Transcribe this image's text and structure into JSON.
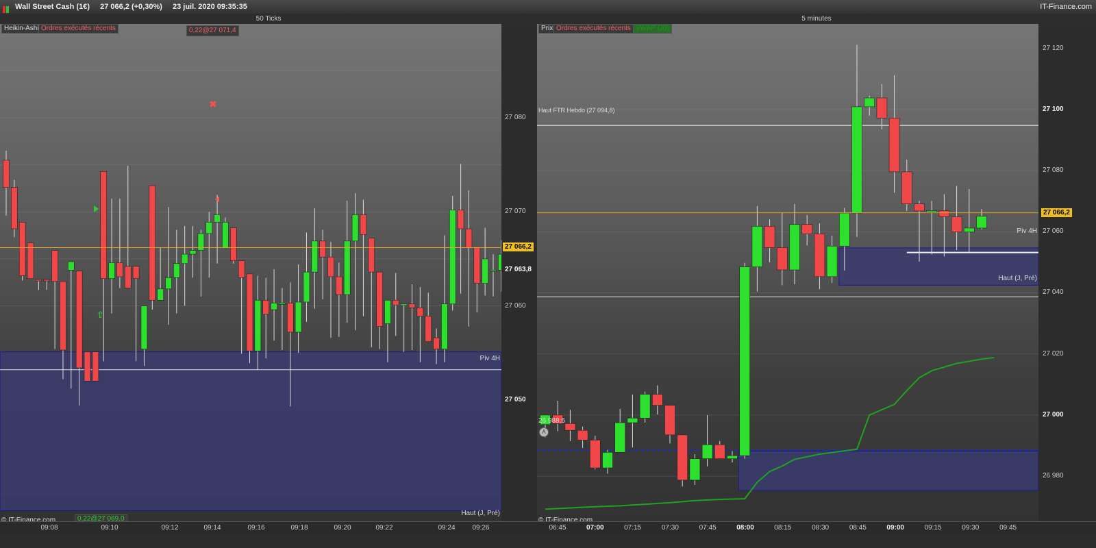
{
  "window": {
    "instrument": "Wall Street Cash (1€)",
    "price_change": "27 066,2 (+0,30%)",
    "datetime": "23 juil. 2020 09:35:35",
    "brand": "IT-Finance.com"
  },
  "colors": {
    "up": "#2ee02e",
    "down": "#f04848",
    "zone": "#3b3b6e",
    "current": "#e8a020"
  },
  "left_panel": {
    "title": "50 Ticks",
    "legend_main": "Heikin-Ashi",
    "legend_orders": "Ordres exécutés récents",
    "order_top": "0,22@27 071,4",
    "order_bottom": "0,22@27 069,0",
    "zone_label": "Piv 4H",
    "line_label": "Haut (J, Pré)",
    "watermark": "© IT-Finance.com",
    "current_price": "27 066,2",
    "last_price": "27 063,8",
    "yticks": [
      {
        "v": 27080,
        "t": "27 080"
      },
      {
        "v": 27070,
        "t": "27 070"
      },
      {
        "v": 27060,
        "t": "27 060"
      },
      {
        "v": 27050,
        "t": "27 050",
        "bold": true
      }
    ],
    "xticks": [
      "09:08",
      "09:10",
      "09:12",
      "09:14",
      "09:16",
      "09:18",
      "09:20",
      "09:22",
      "09:24",
      "09:26"
    ]
  },
  "right_panel": {
    "title": "5 minutes",
    "legend_main": "Prix",
    "legend_orders": "Ordres exécutés récents",
    "legend_vwap": "VWAP (J0)",
    "level_weekly": "Haut FTR Hebdo (27 094,8)",
    "level_pivot": "Piv 4H",
    "level_prev_high": "Haut (J, Pré)",
    "level_low": "26 988,6",
    "watermark": "© IT-Finance.com",
    "current_price": "27 066,2",
    "yticks": [
      {
        "v": 27120,
        "t": "27 120"
      },
      {
        "v": 27100,
        "t": "27 100",
        "bold": true
      },
      {
        "v": 27080,
        "t": "27 080"
      },
      {
        "v": 27060,
        "t": "27 060"
      },
      {
        "v": 27040,
        "t": "27 040"
      },
      {
        "v": 27020,
        "t": "27 020"
      },
      {
        "v": 27000,
        "t": "27 000",
        "bold": true
      },
      {
        "v": 26980,
        "t": "26 980"
      }
    ],
    "xticks": [
      {
        "t": "06:45"
      },
      {
        "t": "07:00",
        "bold": true
      },
      {
        "t": "07:15"
      },
      {
        "t": "07:30"
      },
      {
        "t": "07:45"
      },
      {
        "t": "08:00",
        "bold": true
      },
      {
        "t": "08:15"
      },
      {
        "t": "08:30"
      },
      {
        "t": "08:45"
      },
      {
        "t": "09:00",
        "bold": true
      },
      {
        "t": "09:15"
      },
      {
        "t": "09:30"
      },
      {
        "t": "09:45"
      }
    ]
  },
  "chart_data": [
    {
      "type": "candlestick",
      "title": "50 Ticks",
      "style": "Heikin-Ashi",
      "ylim": [
        27037,
        27090
      ],
      "current_price": 27066.2,
      "zone": {
        "name": "Piv 4H",
        "low": 27038.2,
        "high": 27055.1
      },
      "level": 27053.2,
      "candles": [
        [
          27075.5,
          27076.5,
          27069.6,
          27072.6
        ],
        [
          27072.6,
          27073.4,
          27067.3,
          27068.2
        ],
        [
          27068.9,
          27068.9,
          27062.7,
          27063.2
        ],
        [
          27066.7,
          27066.7,
          27062.9,
          27062.9
        ],
        [
          27062.8,
          27062.8,
          27061.7,
          27062.7
        ],
        [
          27062.8,
          27062.8,
          27061.7,
          27062.7
        ],
        [
          27065.9,
          27065.9,
          27055.4,
          27062.6
        ],
        [
          27062.6,
          27062.6,
          27052.2,
          27055.3
        ],
        [
          27063.8,
          27063.8,
          27051.2,
          27064.7
        ],
        [
          27063.7,
          27063.7,
          27049.4,
          27053.4
        ],
        [
          27055.1,
          27055.1,
          27054.6,
          27052.0
        ],
        [
          27055.1,
          27055.1,
          27054.6,
          27052.0
        ],
        [
          27074.3,
          27074.3,
          27054.1,
          27062.9
        ],
        [
          27062.9,
          27071.4,
          27059.2,
          27064.6
        ],
        [
          27064.6,
          27071.4,
          27061.9,
          27063.1
        ],
        [
          27064.2,
          27074.9,
          27063.4,
          27061.9
        ],
        [
          27064.2,
          27064.2,
          27054.1,
          27062.9
        ],
        [
          27055.4,
          27055.4,
          27053.6,
          27060.0
        ],
        [
          27072.8,
          27072.8,
          27059.6,
          27060.6
        ],
        [
          27060.6,
          27066.2,
          27061.7,
          27061.8
        ],
        [
          27061.8,
          27070.5,
          27058.0,
          27063.0
        ],
        [
          27063.0,
          27068.1,
          27059.2,
          27064.5
        ],
        [
          27064.5,
          27068.5,
          27060.0,
          27065.5
        ],
        [
          27065.5,
          27068.5,
          27063.0,
          27065.9
        ],
        [
          27065.9,
          27068.1,
          27061.0,
          27067.7
        ],
        [
          27067.7,
          27070.0,
          27063.0,
          27068.9
        ],
        [
          27068.9,
          27071.8,
          27064.5,
          27069.7
        ],
        [
          27066.2,
          27069.4,
          27066.4,
          27068.9
        ],
        [
          27068.3,
          27068.3,
          27064.5,
          27064.8
        ],
        [
          27064.8,
          27064.8,
          27054.9,
          27063.0
        ],
        [
          27063.4,
          27063.4,
          27053.9,
          27055.2
        ],
        [
          27055.2,
          27063.2,
          27053.2,
          27060.6
        ],
        [
          27060.6,
          27063.0,
          27054.4,
          27059.1
        ],
        [
          27059.6,
          27063.9,
          27056.3,
          27060.3
        ],
        [
          27060.3,
          27061.9,
          27055.3,
          27060.3
        ],
        [
          27060.3,
          27062.5,
          27049.3,
          27057.2
        ],
        [
          27057.2,
          27064.4,
          27055.0,
          27060.4
        ],
        [
          27060.4,
          27067.8,
          27058.3,
          27063.6
        ],
        [
          27063.6,
          27070.4,
          27059.7,
          27066.9
        ],
        [
          27066.9,
          27068.1,
          27060.7,
          27065.2
        ],
        [
          27065.2,
          27066.8,
          27056.6,
          27063.1
        ],
        [
          27063.1,
          27064.6,
          27056.7,
          27061.2
        ],
        [
          27061.2,
          27071.2,
          27058.2,
          27066.9
        ],
        [
          27066.9,
          27072.0,
          27057.4,
          27069.7
        ],
        [
          27069.7,
          27071.3,
          27058.9,
          27067.6
        ],
        [
          27067.2,
          27067.2,
          27055.6,
          27063.6
        ],
        [
          27063.6,
          27063.6,
          27055.4,
          27057.8
        ],
        [
          27058.1,
          27060.5,
          27054.0,
          27060.6
        ],
        [
          27060.6,
          27063.5,
          27056.8,
          27060.1
        ],
        [
          27060.1,
          27060.2,
          27055.1,
          27060.2
        ],
        [
          27060.2,
          27062.3,
          27055.3,
          27059.8
        ],
        [
          27059.8,
          27062.0,
          27054.0,
          27058.9
        ],
        [
          27058.9,
          27061.4,
          27058.2,
          27056.2
        ],
        [
          27056.6,
          27057.6,
          27053.8,
          27055.4
        ],
        [
          27055.4,
          27067.5,
          27054.0,
          27060.2
        ],
        [
          27060.2,
          27071.7,
          27059.5,
          27070.2
        ],
        [
          27070.2,
          27075.1,
          27061.3,
          27068.2
        ],
        [
          27068.2,
          27072.3,
          27057.8,
          27066.2
        ],
        [
          27066.2,
          27066.2,
          27059.3,
          27062.4
        ],
        [
          27062.4,
          27068.3,
          27061.1,
          27065.0
        ],
        [
          27063.8,
          27065.5,
          27061.0,
          27063.8
        ],
        [
          27063.8,
          27067.0,
          27061.5,
          27065.5
        ]
      ]
    },
    {
      "type": "candlestick",
      "title": "5 minutes",
      "ylim": [
        26965,
        27128
      ],
      "current_price": 27066.2,
      "levels": [
        {
          "name": "Haut FTR Hebdo",
          "value": 27094.8
        },
        {
          "name": "Haut (J, Pré)",
          "value": 27038.7
        },
        {
          "name": "26 988,6",
          "value": 26988.6,
          "style": "dashed"
        }
      ],
      "zones": [
        {
          "name": "Piv 4H",
          "from_index": 24,
          "low": 27042.5,
          "high": 27054.7
        },
        {
          "name": "zone-low",
          "from_index": 16,
          "low": 26975.3,
          "high": 26988.2
        }
      ],
      "candles": [
        [
          26996.9,
          27000.0,
          26992.7,
          27000.0
        ],
        [
          27000.0,
          27004.7,
          26994.7,
          26997.2
        ],
        [
          26997.2,
          27001.7,
          26991.5,
          26995.0
        ],
        [
          26995.0,
          26996.2,
          26989.2,
          26991.8
        ],
        [
          26991.8,
          26993.2,
          26982.2,
          26982.7
        ],
        [
          26982.7,
          26988.6,
          26980.8,
          26987.8
        ],
        [
          26987.8,
          27002.0,
          26987.8,
          26997.5
        ],
        [
          26997.5,
          27006.7,
          26989.4,
          26999.0
        ],
        [
          26999.0,
          27007.7,
          26997.5,
          27006.8
        ],
        [
          27006.8,
          27009.7,
          27000.2,
          27003.2
        ],
        [
          27003.2,
          27003.2,
          26990.7,
          26993.5
        ],
        [
          26993.5,
          26993.5,
          26976.6,
          26978.7
        ],
        [
          26978.7,
          26987.2,
          26977.1,
          26985.7
        ],
        [
          26985.7,
          27000.0,
          26983.2,
          26990.3
        ],
        [
          26990.3,
          26991.5,
          26986.2,
          26985.7
        ],
        [
          26985.7,
          26988.2,
          26984.5,
          26986.7
        ],
        [
          26986.7,
          27049.8,
          26985.7,
          27048.5
        ],
        [
          27048.5,
          27068.4,
          27040.4,
          27061.8
        ],
        [
          27061.8,
          27064.0,
          27050.0,
          27054.8
        ],
        [
          27054.8,
          27066.2,
          27042.5,
          27047.5
        ],
        [
          27047.5,
          27069.1,
          27042.8,
          27062.4
        ],
        [
          27062.4,
          27065.5,
          27055.5,
          27059.3
        ],
        [
          27059.3,
          27062.7,
          27041.2,
          27045.3
        ],
        [
          27045.3,
          27058.7,
          27043.2,
          27055.3
        ],
        [
          27055.3,
          27067.8,
          27047.3,
          27066.1
        ],
        [
          27066.1,
          27121.2,
          27058.3,
          27100.9
        ],
        [
          27100.9,
          27104.5,
          27098.0,
          27103.8
        ],
        [
          27103.8,
          27108.3,
          27093.5,
          27097.2
        ],
        [
          27097.2,
          27111.2,
          27072.8,
          27079.6
        ],
        [
          27079.6,
          27083.6,
          27066.8,
          27069.1
        ],
        [
          27069.1,
          27070.1,
          27050.2,
          27066.8
        ],
        [
          27066.8,
          27070.1,
          27052.6,
          27066.9
        ],
        [
          27066.9,
          27072.3,
          27051.9,
          27064.9
        ],
        [
          27064.9,
          27075.0,
          27054.0,
          27059.9
        ],
        [
          27059.9,
          27074.0,
          27053.4,
          27061.2
        ],
        [
          27061.2,
          27067.4,
          27060.8,
          27065.1
        ]
      ],
      "vwap": [
        [
          0,
          26969.2
        ],
        [
          2,
          26969.6
        ],
        [
          4,
          26970.0
        ],
        [
          6,
          26970.3
        ],
        [
          8,
          26970.8
        ],
        [
          10,
          26971.3
        ],
        [
          12,
          26972.0
        ],
        [
          14,
          26972.4
        ],
        [
          16,
          26972.6
        ],
        [
          17,
          26978.0
        ],
        [
          18,
          26981.5
        ],
        [
          19,
          26983.3
        ],
        [
          20,
          26985.5
        ],
        [
          22,
          26987.2
        ],
        [
          24,
          26988.3
        ],
        [
          25,
          26988.8
        ],
        [
          26,
          27000.0
        ],
        [
          28,
          27003.5
        ],
        [
          29,
          27008.0
        ],
        [
          30,
          27012.2
        ],
        [
          31,
          27014.5
        ],
        [
          33,
          27016.9
        ],
        [
          35,
          27018.3
        ],
        [
          36,
          27018.8
        ]
      ]
    }
  ]
}
